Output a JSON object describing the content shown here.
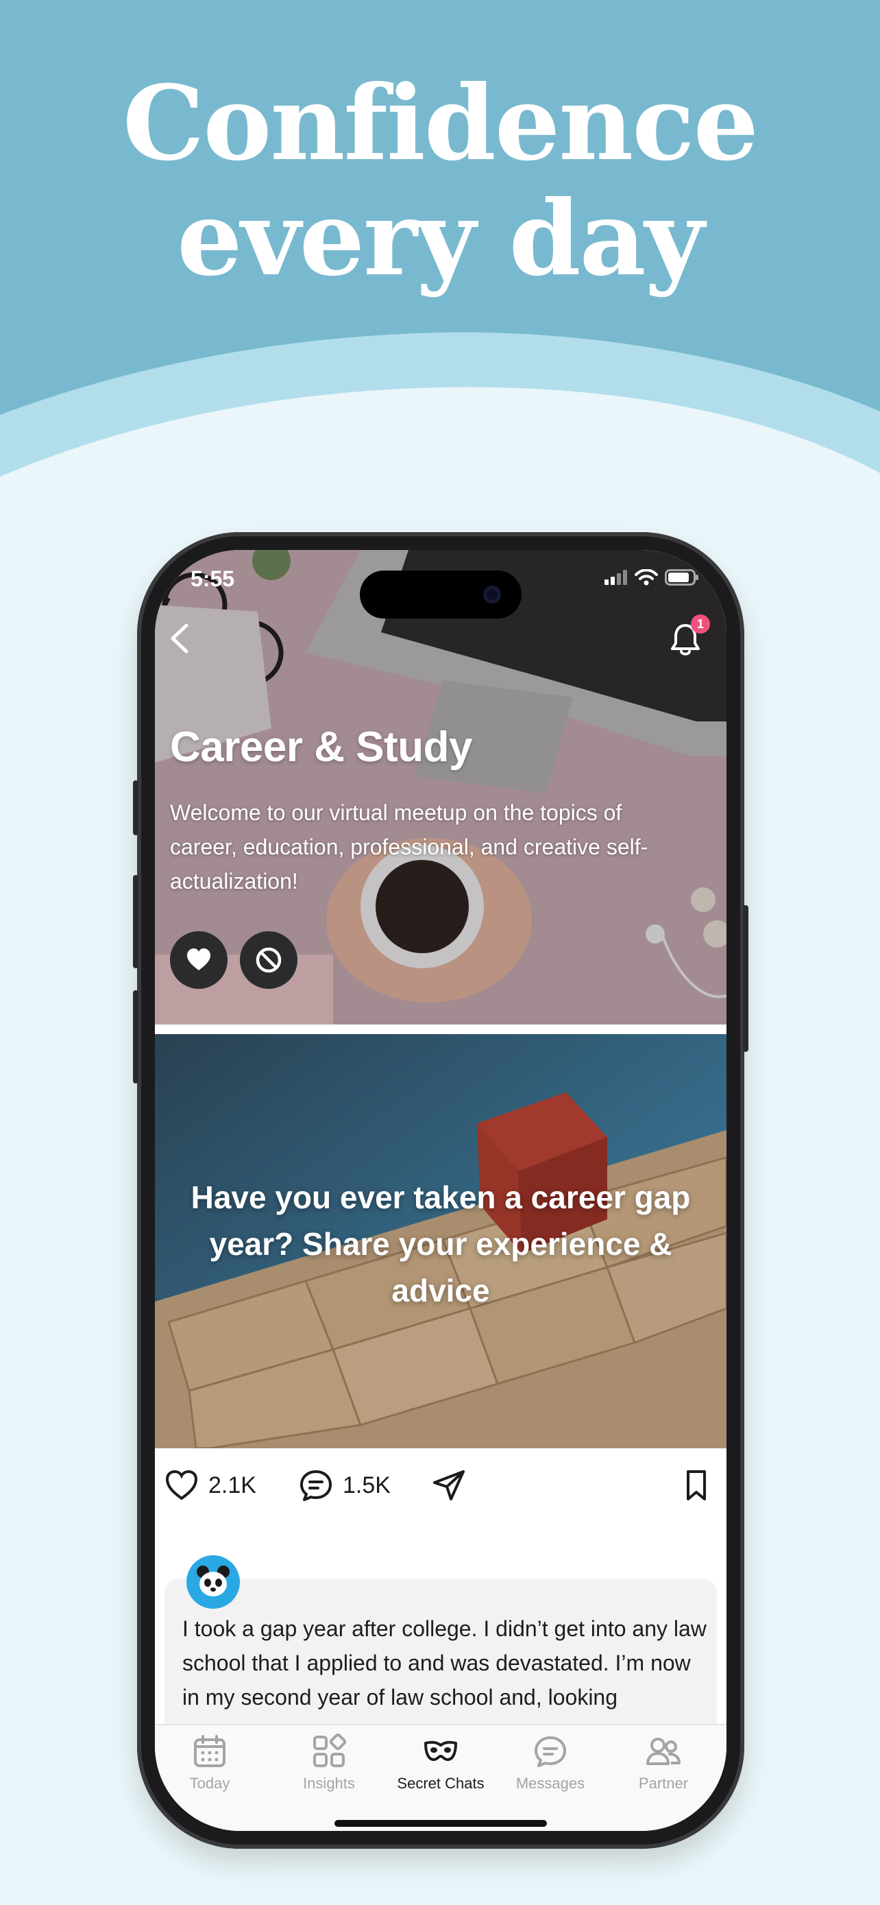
{
  "promo": {
    "headline_line1": "Confidence",
    "headline_line2": "every day",
    "colors": {
      "top_band": "#79b9cf",
      "wave_light": "#b2deec",
      "background": "#eaf6f9"
    }
  },
  "status_bar": {
    "time": "5:55",
    "icons": [
      "signal-icon",
      "wifi-icon",
      "battery-icon"
    ]
  },
  "header": {
    "back_icon": "chevron-left-icon",
    "bell_icon": "bell-icon",
    "notification_count": "1"
  },
  "topic": {
    "title": "Career & Study",
    "description": "Welcome to our virtual meetup on the topics of career, education, professional, and creative self-actualization!",
    "actions": [
      "heart-icon",
      "block-icon"
    ]
  },
  "post": {
    "caption": "Have you ever taken a career gap year? Share your experience & advice",
    "likes": "2.1K",
    "comments": "1.5K",
    "icons": [
      "heart-outline-icon",
      "comment-icon",
      "send-icon",
      "bookmark-icon"
    ]
  },
  "comment": {
    "avatar": "panda-avatar",
    "text": "I took a gap year after college. I didn’t get into any law school that I applied to and was devastated. I’m now in my second year of law school and, looking"
  },
  "tabs": [
    {
      "label": "Today",
      "icon": "calendar-icon"
    },
    {
      "label": "Insights",
      "icon": "shapes-icon"
    },
    {
      "label": "Secret Chats",
      "icon": "mask-icon",
      "active": true
    },
    {
      "label": "Messages",
      "icon": "chat-bubble-icon"
    },
    {
      "label": "Partner",
      "icon": "people-icon"
    }
  ]
}
